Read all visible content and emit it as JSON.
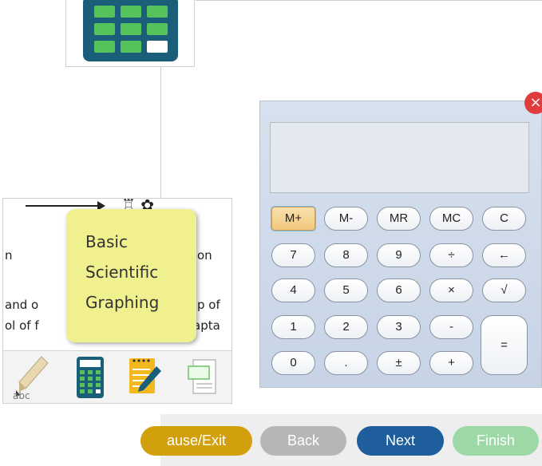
{
  "tooltip": {
    "items": [
      "Basic",
      "Scientific",
      "Graphing"
    ]
  },
  "passage": {
    "lines": [
      {
        "left": "n",
        "right": "on"
      },
      {
        "left": "and o",
        "right": "p of"
      },
      {
        "left": "ol of f",
        "right": "apta"
      }
    ],
    "highlighter_label": "abc"
  },
  "calculator": {
    "display_value": "",
    "keys": {
      "mplus": "M+",
      "mminus": "M-",
      "mr": "MR",
      "mc": "MC",
      "clear": "C",
      "seven": "7",
      "eight": "8",
      "nine": "9",
      "divide": "÷",
      "backspace": "←",
      "four": "4",
      "five": "5",
      "six": "6",
      "multiply": "×",
      "sqrt": "√",
      "one": "1",
      "two": "2",
      "three": "3",
      "minus": "-",
      "equals": "=",
      "zero": "0",
      "decimal": ".",
      "plusminus": "±",
      "plus": "+"
    },
    "close_glyph": "×"
  },
  "nav": {
    "pause_exit": "ause/Exit",
    "back": "Back",
    "next": "Next",
    "finish": "Finish"
  },
  "colors": {
    "calculator_icon": "#1b5e7a",
    "calculator_keys_icon": "#55c25b",
    "tooltip_bg": "#f0f08f",
    "pause_button": "#d3a00d",
    "back_button": "#b6b6b6",
    "next_button": "#1e5e9c",
    "finish_button": "#9dd8a7",
    "close_button": "#e03c3c"
  }
}
